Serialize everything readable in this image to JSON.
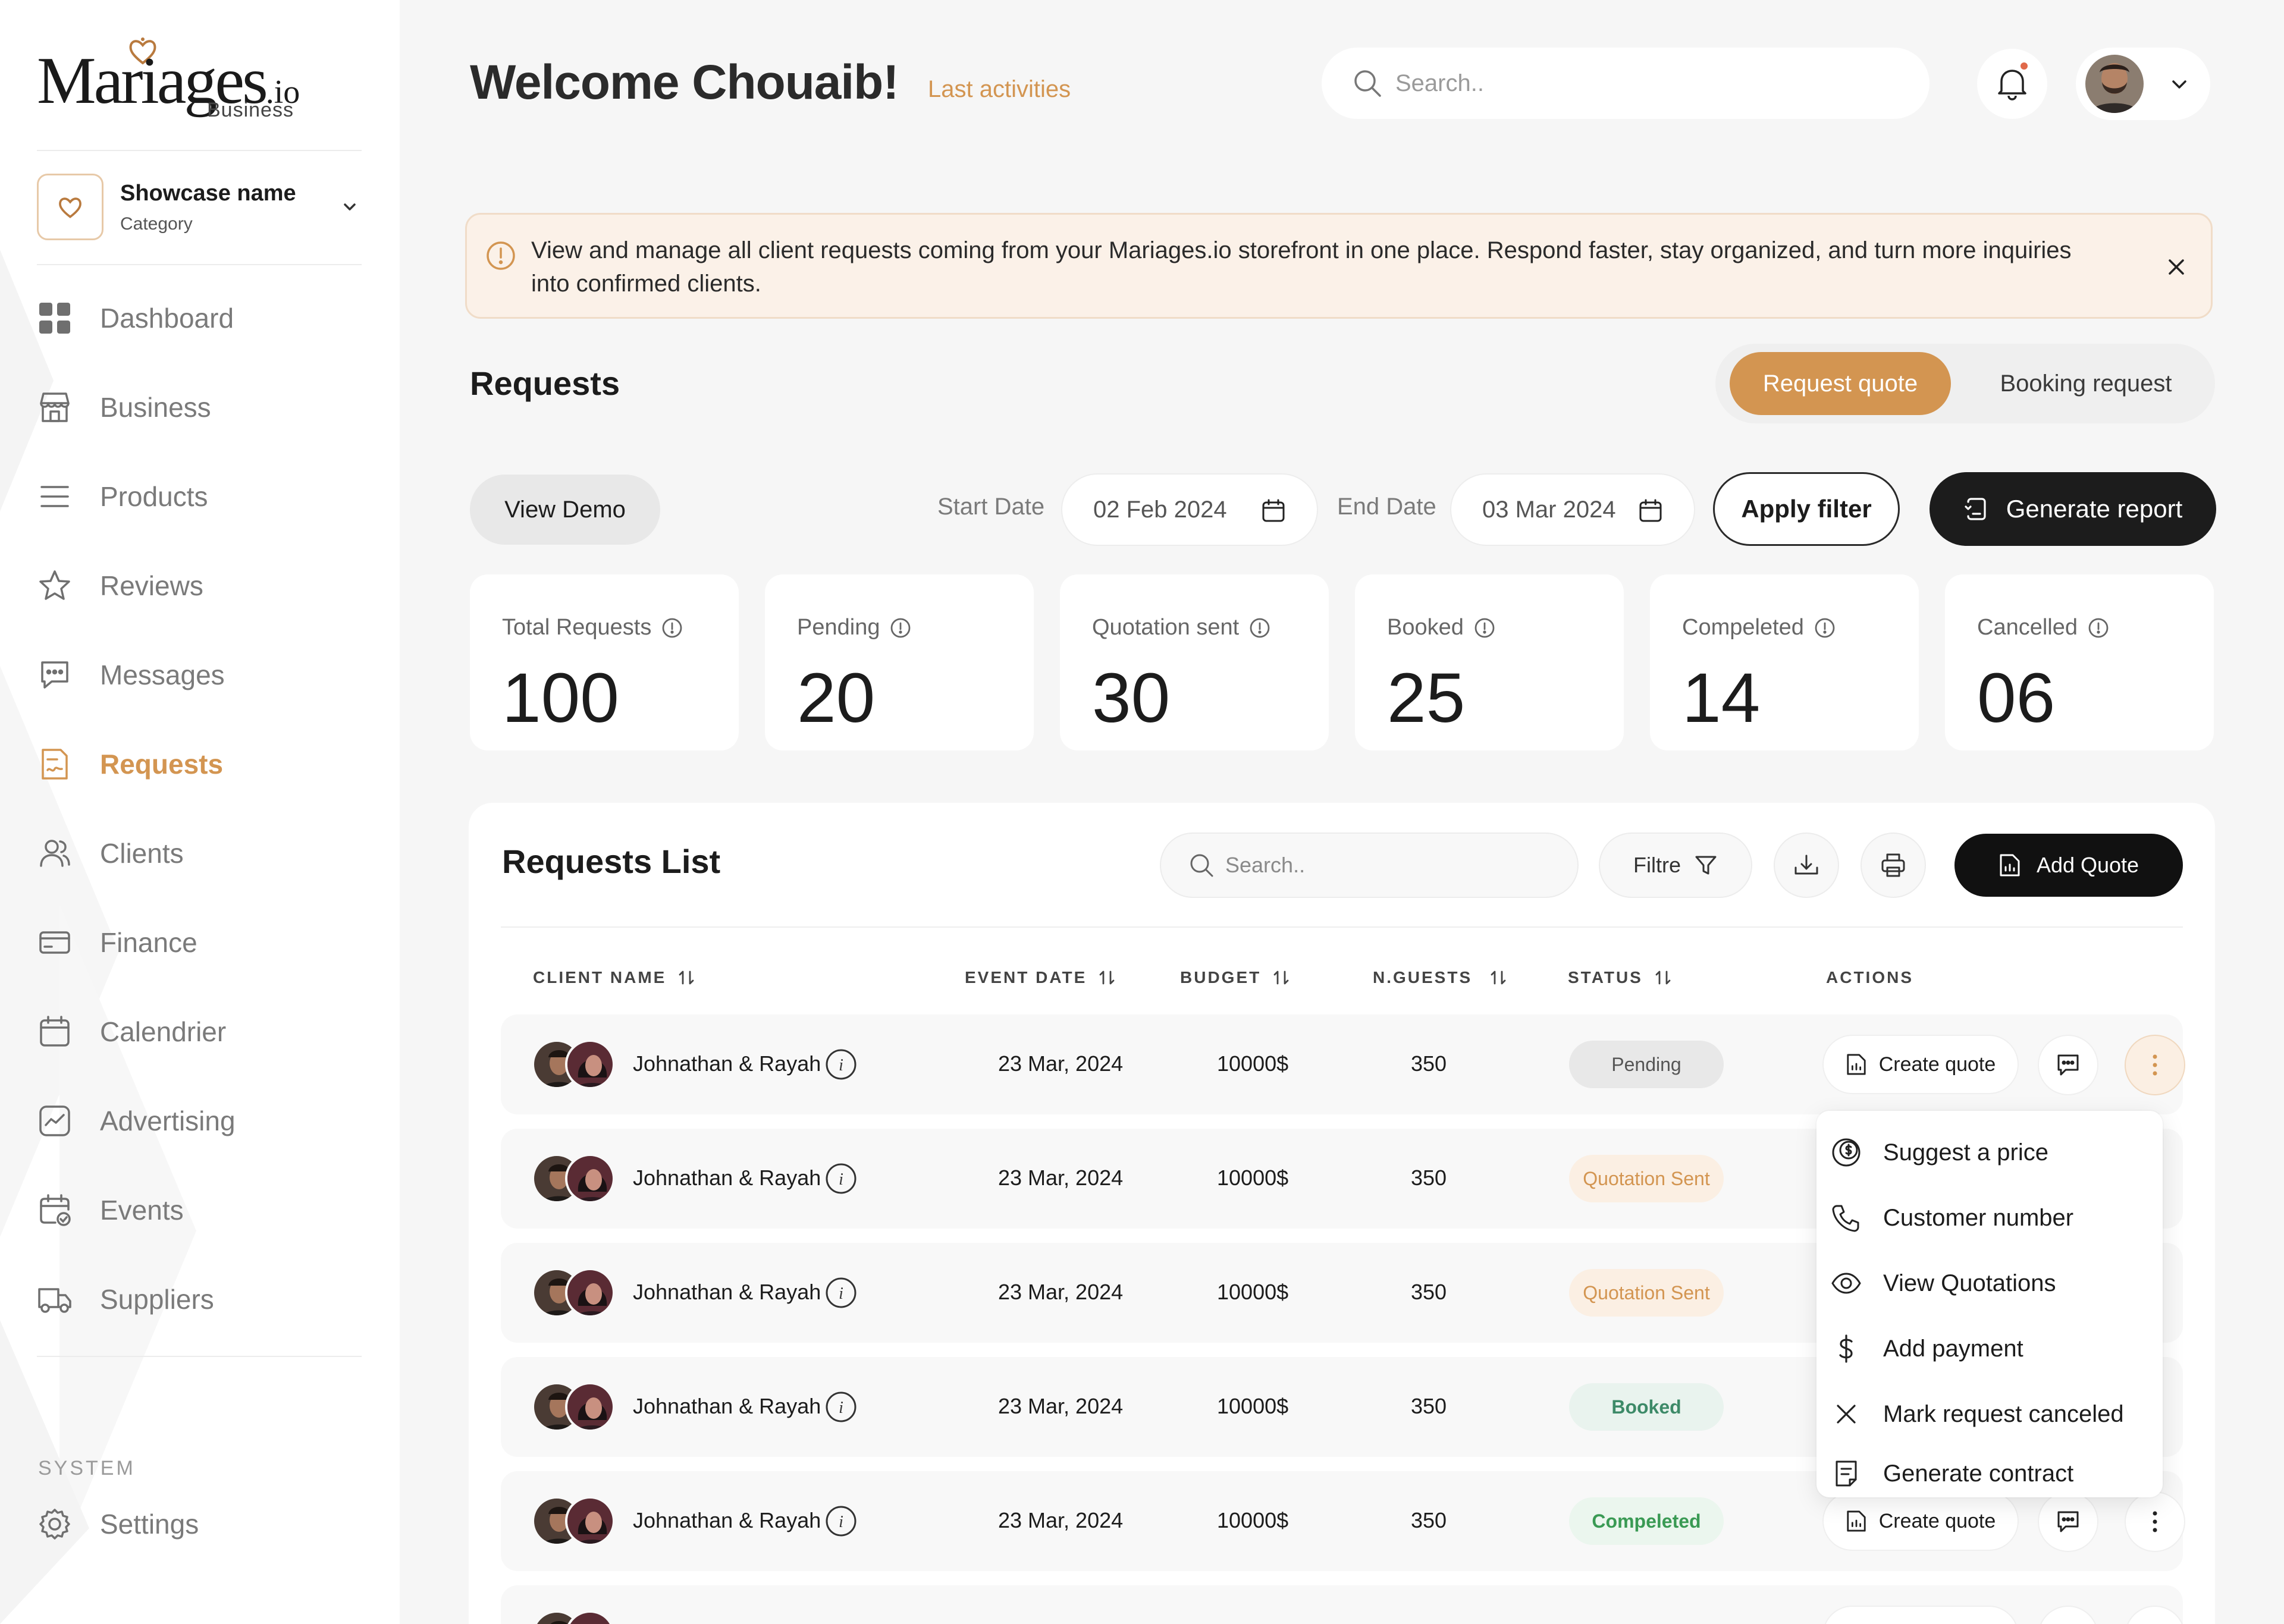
{
  "app": {
    "logo_main": "Mariages",
    "logo_io": ".io",
    "logo_sub": "Business"
  },
  "showcase": {
    "name": "Showcase name",
    "category": "Category"
  },
  "nav": [
    {
      "label": "Dashboard",
      "icon": "grid-icon",
      "active": false
    },
    {
      "label": "Business",
      "icon": "storefront-icon",
      "active": false
    },
    {
      "label": "Products",
      "icon": "list-icon",
      "active": false
    },
    {
      "label": "Reviews",
      "icon": "star-icon",
      "active": false
    },
    {
      "label": "Messages",
      "icon": "chat-icon",
      "active": false
    },
    {
      "label": "Requests",
      "icon": "document-icon",
      "active": true
    },
    {
      "label": "Clients",
      "icon": "users-icon",
      "active": false
    },
    {
      "label": "Finance",
      "icon": "card-icon",
      "active": false
    },
    {
      "label": "Calendrier",
      "icon": "calendar-icon",
      "active": false
    },
    {
      "label": "Advertising",
      "icon": "chart-icon",
      "active": false
    },
    {
      "label": "Events",
      "icon": "event-calendar-icon",
      "active": false
    },
    {
      "label": "Suppliers",
      "icon": "truck-icon",
      "active": false
    }
  ],
  "system": {
    "label": "SYSTEM",
    "settings_label": "Settings"
  },
  "header": {
    "welcome": "Welcome Chouaib!",
    "last_activities": "Last activities",
    "search_placeholder": "Search.."
  },
  "banner": {
    "text": "View and manage all client requests coming from your Mariages.io storefront in one place. Respond faster, stay organized, and turn more inquiries into confirmed clients."
  },
  "requests": {
    "title": "Requests",
    "tabs": [
      {
        "label": "Request quote",
        "active": true
      },
      {
        "label": "Booking request",
        "active": false
      }
    ],
    "view_demo": "View Demo",
    "start_label": "Start Date",
    "start_value": "02 Feb 2024",
    "end_label": "End Date",
    "end_value": "03 Mar 2024",
    "apply_filter": "Apply filter",
    "generate_report": "Generate report"
  },
  "stats": [
    {
      "label": "Total Requests",
      "value": "100"
    },
    {
      "label": "Pending",
      "value": "20"
    },
    {
      "label": "Quotation sent",
      "value": "30"
    },
    {
      "label": "Booked",
      "value": "25"
    },
    {
      "label": "Compeleted",
      "value": "14"
    },
    {
      "label": "Cancelled",
      "value": "06"
    }
  ],
  "list": {
    "title": "Requests List",
    "search_placeholder": "Search..",
    "filter_label": "Filtre",
    "add_quote": "Add Quote",
    "columns": [
      "CLIENT NAME",
      "EVENT DATE",
      "BUDGET",
      "N.GUESTS",
      "STATUS",
      "ACTIONS"
    ],
    "create_quote_label": "Create quote",
    "rows": [
      {
        "client": "Johnathan & Rayah",
        "date": "23 Mar, 2024",
        "budget": "10000$",
        "guests": "350",
        "status": "Pending",
        "status_kind": "pending"
      },
      {
        "client": "Johnathan & Rayah",
        "date": "23 Mar, 2024",
        "budget": "10000$",
        "guests": "350",
        "status": "Quotation Sent",
        "status_kind": "sent"
      },
      {
        "client": "Johnathan & Rayah",
        "date": "23 Mar, 2024",
        "budget": "10000$",
        "guests": "350",
        "status": "Quotation Sent",
        "status_kind": "sent"
      },
      {
        "client": "Johnathan & Rayah",
        "date": "23 Mar, 2024",
        "budget": "10000$",
        "guests": "350",
        "status": "Booked",
        "status_kind": "booked"
      },
      {
        "client": "Johnathan & Rayah",
        "date": "23 Mar, 2024",
        "budget": "10000$",
        "guests": "350",
        "status": "Compeleted",
        "status_kind": "completed"
      }
    ]
  },
  "menu": [
    {
      "label": "Suggest a price",
      "icon": "dollar-circle-icon"
    },
    {
      "label": "Customer number",
      "icon": "phone-icon"
    },
    {
      "label": "View Quotations",
      "icon": "eye-icon"
    },
    {
      "label": "Add payment",
      "icon": "dollar-icon"
    },
    {
      "label": "Mark request canceled",
      "icon": "x-icon"
    },
    {
      "label": "Generate contract",
      "icon": "contract-icon"
    }
  ],
  "colors": {
    "accent": "#d39551",
    "dark": "#1c1c1c",
    "background": "#f6f6f6"
  }
}
